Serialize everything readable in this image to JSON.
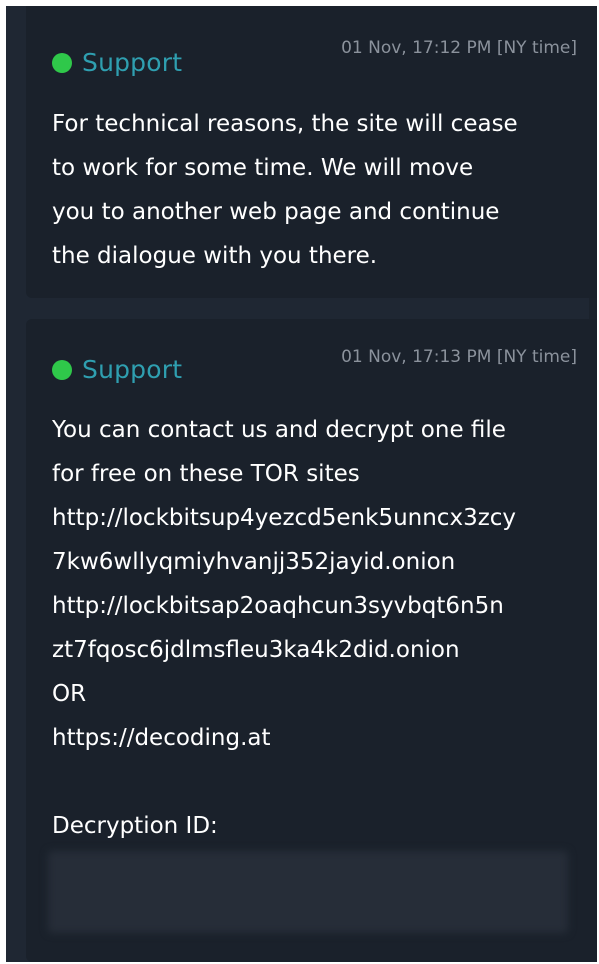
{
  "messages": [
    {
      "sender": "Support",
      "timestamp": "01 Nov, 17:12 PM [NY time]",
      "lines": [
        "For technical reasons, the site will cease",
        "to work for some time. We will move",
        "you to another web page and continue",
        "the dialogue with you there."
      ]
    },
    {
      "sender": "Support",
      "timestamp": "01 Nov, 17:13 PM [NY time]",
      "lines": [
        "You can contact us and decrypt one file",
        "for free on these TOR sites",
        "http://lockbitsup4yezcd5enk5unncx3zcy",
        "7kw6wllyqmiyhvanjj352jayid.onion",
        "http://lockbitsap2oaqhcun3syvbqt6n5n",
        "zt7fqosc6jdlmsfleu3ka4k2did.onion",
        "OR",
        "https://decoding.at",
        "",
        "Decryption ID:"
      ]
    }
  ],
  "colors": {
    "background": "#1f2733",
    "message_bg": "#1a212b",
    "sender": "#2f9fb0",
    "online_dot": "#2fc84a",
    "timestamp": "#8b929c",
    "text": "#ffffff"
  },
  "icons": {
    "status": "online-dot-icon"
  }
}
